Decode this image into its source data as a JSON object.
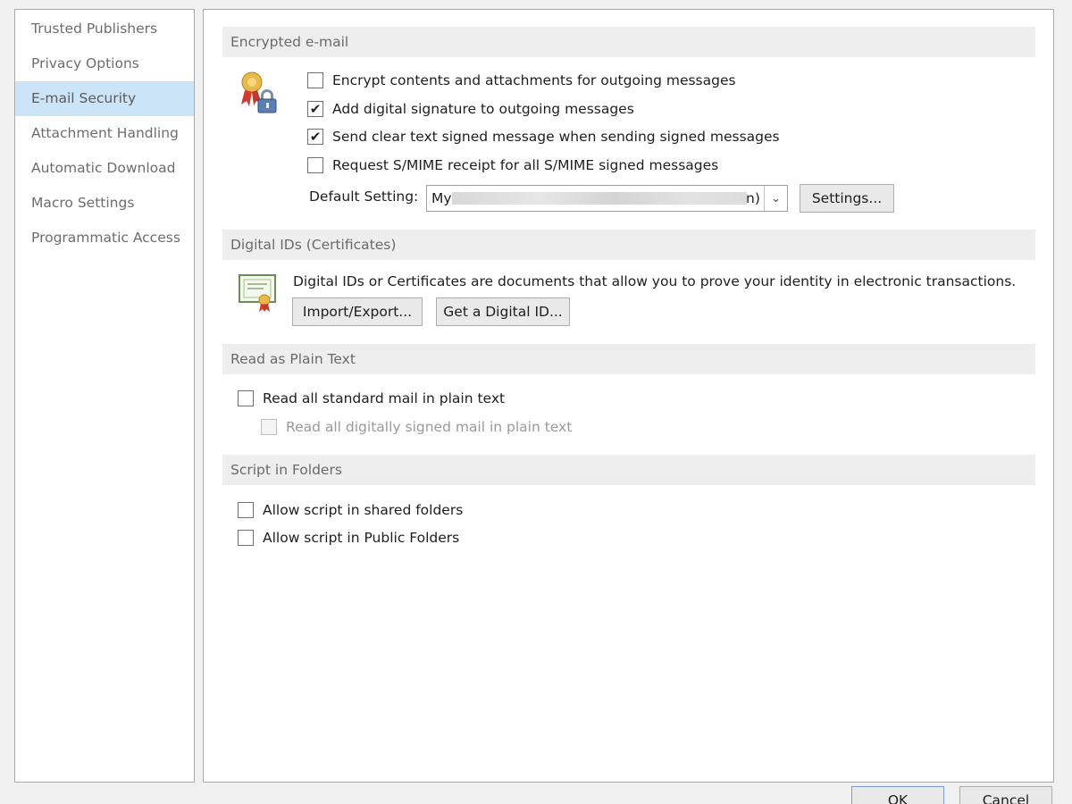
{
  "sidebar": {
    "items": [
      {
        "label": "Trusted Publishers"
      },
      {
        "label": "Privacy Options"
      },
      {
        "label": "E-mail Security",
        "selected": true
      },
      {
        "label": "Attachment Handling"
      },
      {
        "label": "Automatic Download"
      },
      {
        "label": "Macro Settings"
      },
      {
        "label": "Programmatic Access"
      }
    ]
  },
  "encrypted": {
    "header": "Encrypted e-mail",
    "options": [
      {
        "label": "Encrypt contents and attachments for outgoing messages",
        "checked": false
      },
      {
        "label": "Add digital signature to outgoing messages",
        "checked": true
      },
      {
        "label": "Send clear text signed message when sending signed messages",
        "checked": true
      },
      {
        "label": "Request S/MIME receipt for all S/MIME signed messages",
        "checked": false
      }
    ],
    "default_setting_label": "Default Setting:",
    "default_setting_value_start": "My",
    "default_setting_value_end": "n)",
    "settings_button": "Settings..."
  },
  "digital_ids": {
    "header": "Digital IDs (Certificates)",
    "description": "Digital IDs or Certificates are documents that allow you to prove your identity in electronic transactions.",
    "import_export_button": "Import/Export...",
    "get_id_button": "Get a Digital ID..."
  },
  "plain_text": {
    "header": "Read as Plain Text",
    "read_all_standard": {
      "label": "Read all standard mail in plain text",
      "checked": false
    },
    "read_all_signed": {
      "label": "Read all digitally signed mail in plain text",
      "checked": false,
      "disabled": true
    }
  },
  "script_folders": {
    "header": "Script in Folders",
    "options": [
      {
        "label": "Allow script in shared folders",
        "checked": false
      },
      {
        "label": "Allow script in Public Folders",
        "checked": false
      }
    ]
  },
  "footer": {
    "ok_button": "OK",
    "cancel_button": "Cancel"
  },
  "colors": {
    "selected_bg": "#cce4f7",
    "section_header_bg": "#eeeeee"
  },
  "icons": {
    "encryption": "certificate-lock-icon",
    "digital_id": "certificate-document-icon"
  }
}
